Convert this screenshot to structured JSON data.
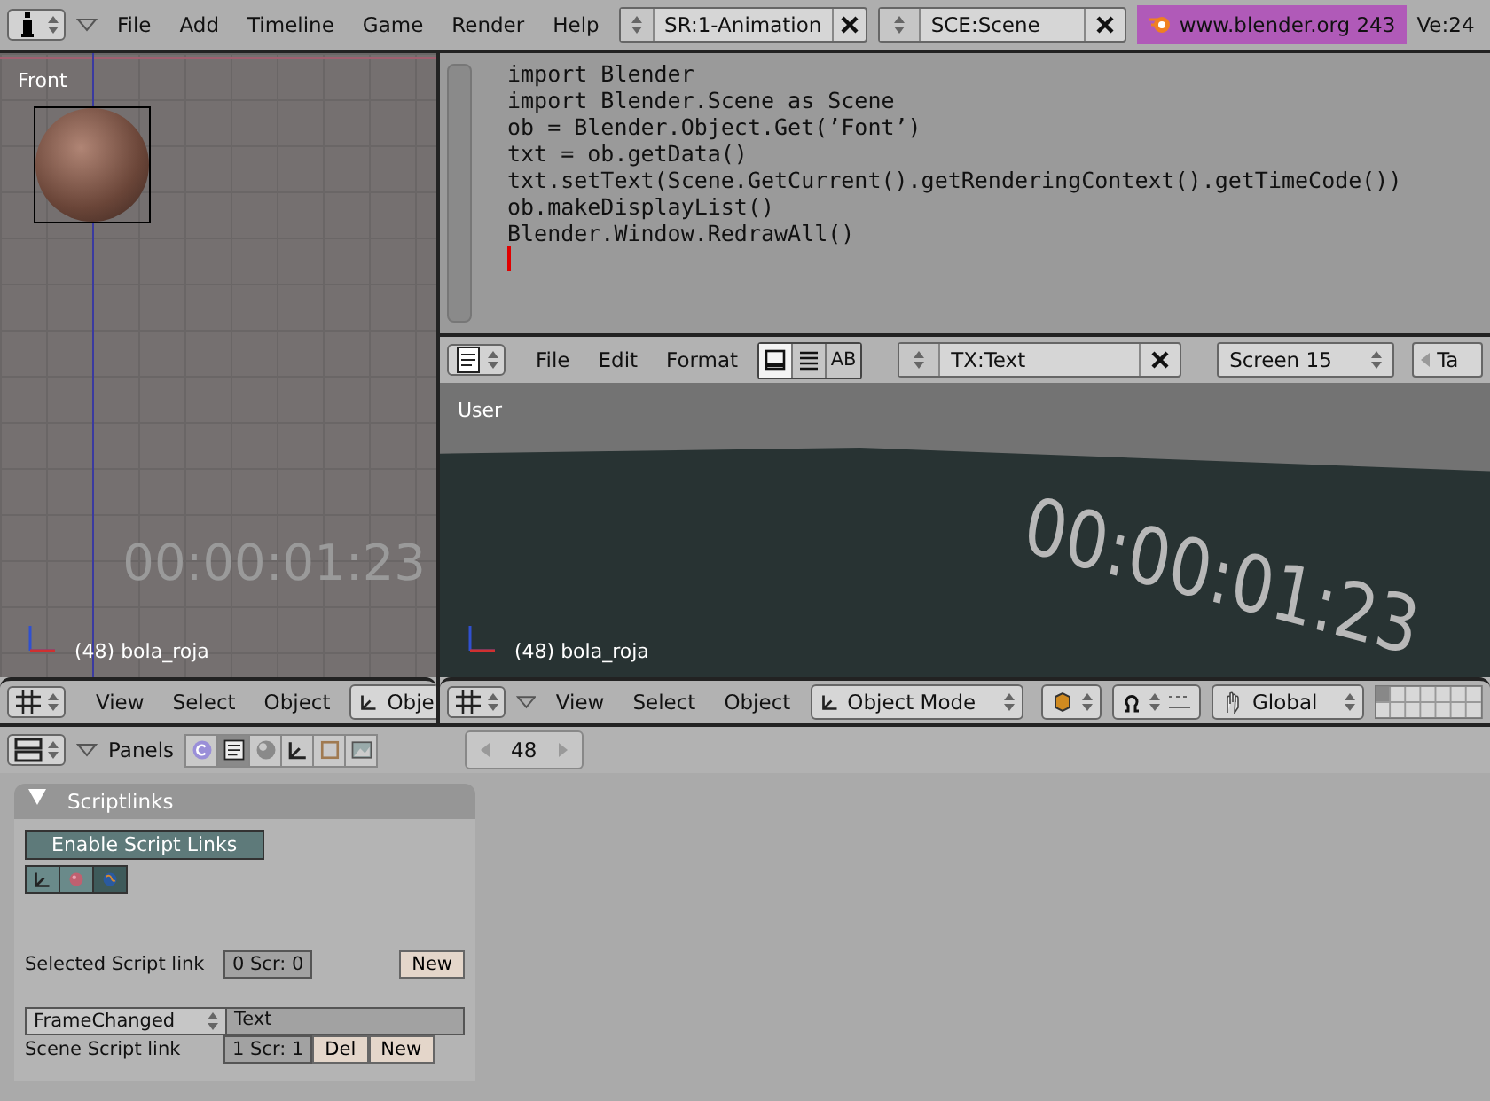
{
  "top_bar": {
    "menus": [
      "File",
      "Add",
      "Timeline",
      "Game",
      "Render",
      "Help"
    ],
    "screen_field": "SR:1-Animation",
    "scene_field": "SCE:Scene",
    "splash_label": "www.blender.org 243",
    "stats": "Ve:24"
  },
  "front_view": {
    "title": "Front",
    "timecode": "00:00:01:23",
    "object_label": "(48) bola_roja",
    "header": {
      "menus": [
        "View",
        "Select",
        "Object"
      ],
      "mode": "Obje"
    }
  },
  "text_editor": {
    "lines": [
      "import Blender",
      "import Blender.Scene as Scene",
      "ob = Blender.Object.Get(’Font’)",
      "txt = ob.getData()",
      "txt.setText(Scene.GetCurrent().getRenderingContext().getTimeCode())",
      "ob.makeDisplayList()",
      "Blender.Window.RedrawAll()"
    ],
    "header": {
      "menus": [
        "File",
        "Edit",
        "Format"
      ],
      "toggles": [
        {
          "kind": "lines",
          "selected": true
        },
        {
          "kind": "wrap",
          "selected": false
        },
        {
          "kind": "text",
          "label": "AB",
          "selected": false
        }
      ],
      "text_field": "TX:Text",
      "font_size": "Screen 15",
      "tab_field": "Ta"
    }
  },
  "user_view": {
    "title": "User",
    "timecode": "00:00:01:23",
    "object_label": "(48) bola_roja",
    "header": {
      "menus": [
        "View",
        "Select",
        "Object"
      ],
      "mode": "Object Mode",
      "orientation": "Global"
    }
  },
  "buttons_window": {
    "header": {
      "label": "Panels",
      "frame": "48",
      "context_tabs": [
        {
          "kind": "logic",
          "selected": false
        },
        {
          "kind": "script",
          "selected": true
        },
        {
          "kind": "shading",
          "selected": false
        },
        {
          "kind": "object",
          "selected": false
        },
        {
          "kind": "editing",
          "selected": false
        },
        {
          "kind": "scene",
          "selected": false
        }
      ]
    },
    "panel": {
      "title": "Scriptlinks",
      "enable_button": "Enable Script Links",
      "link_tabs": [
        {
          "kind": "object",
          "selected": false
        },
        {
          "kind": "material",
          "selected": false
        },
        {
          "kind": "world",
          "selected": true
        }
      ],
      "selected_label": "Selected Script link",
      "selected_field": "0 Scr: 0",
      "selected_new": "New",
      "event": "FrameChanged",
      "script_field": "Text",
      "scene_label": "Scene Script link",
      "scene_field": "1 Scr: 1",
      "del_button": "Del",
      "scene_new": "New"
    }
  }
}
